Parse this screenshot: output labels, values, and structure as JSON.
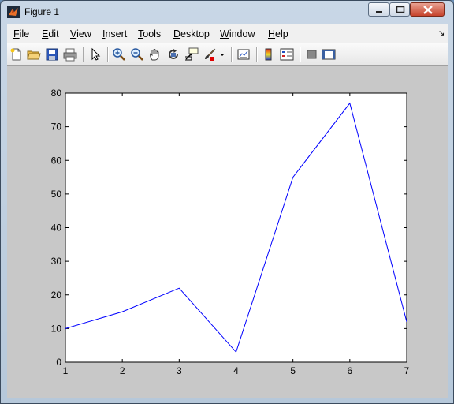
{
  "window": {
    "title": "Figure 1"
  },
  "menu": [
    {
      "key": "F",
      "rest": "ile"
    },
    {
      "key": "E",
      "rest": "dit"
    },
    {
      "key": "V",
      "rest": "iew"
    },
    {
      "key": "I",
      "rest": "nsert"
    },
    {
      "key": "T",
      "rest": "ools"
    },
    {
      "key": "D",
      "rest": "esktop"
    },
    {
      "key": "W",
      "rest": "indow"
    },
    {
      "key": "H",
      "rest": "elp"
    }
  ],
  "toolbar_icons": [
    "new-figure-icon",
    "open-file-icon",
    "save-icon",
    "print-icon",
    "pointer-icon",
    "zoom-in-icon",
    "zoom-out-icon",
    "pan-hand-icon",
    "rotate-3d-icon",
    "data-cursor-icon",
    "brush-icon",
    "dropdown-arrow-icon",
    "link-plot-icon",
    "colorbar-icon",
    "legend-icon",
    "hide-plot-tools-icon",
    "show-plot-tools-icon"
  ],
  "chart_data": {
    "type": "line",
    "x": [
      1,
      2,
      3,
      4,
      5,
      6,
      7
    ],
    "series": [
      {
        "values": [
          10,
          15,
          22,
          3,
          55,
          77,
          12
        ],
        "color": "#0000ff"
      }
    ],
    "xlim": [
      1,
      7
    ],
    "ylim": [
      0,
      80
    ],
    "xticks": [
      "1",
      "2",
      "3",
      "4",
      "5",
      "6",
      "7"
    ],
    "yticks": [
      "0",
      "10",
      "20",
      "30",
      "40",
      "50",
      "60",
      "70",
      "80"
    ],
    "grid": false
  }
}
